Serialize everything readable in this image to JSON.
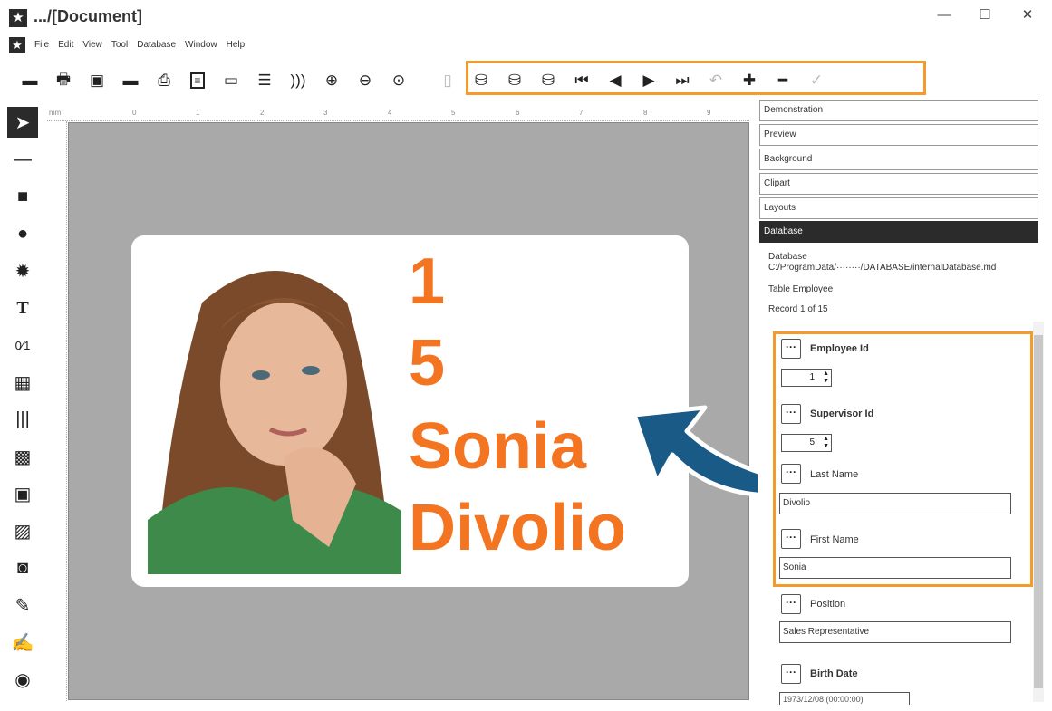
{
  "window": {
    "title": ".../[Document]",
    "controls": {
      "minimize": "—",
      "maximize": "☐",
      "close": "✕"
    }
  },
  "menu": [
    "File",
    "Edit",
    "View",
    "Tool",
    "Database",
    "Window",
    "Help"
  ],
  "toolbar": {
    "icons": [
      "new-card-icon",
      "print-icon",
      "save-icon",
      "new-icon",
      "printer-icon",
      "card-front-icon",
      "card-back-icon",
      "layers-icon",
      "encode-icon",
      "zoom-in-icon",
      "zoom-out-icon",
      "zoom-fit-icon"
    ],
    "db_nav_icons": [
      "db-disabled-icon",
      "db-connect-icon",
      "db-disconnect-icon",
      "db-refresh-icon",
      "db-first-icon",
      "db-previous-icon",
      "db-next-icon",
      "db-last-icon",
      "db-undo-icon",
      "db-add-record-icon",
      "db-remove-record-icon",
      "db-confirm-icon"
    ]
  },
  "left_tools": [
    "pointer-icon",
    "line-icon",
    "rectangle-icon",
    "ellipse-icon",
    "star-shape-icon",
    "text-icon",
    "counter-icon",
    "date-icon",
    "barcode-icon",
    "qrcode-icon",
    "image-icon",
    "picture-icon",
    "camera-icon",
    "signature-pad-icon",
    "sign-icon",
    "fingerprint-icon"
  ],
  "ruler": {
    "unit": "mm",
    "marks": [
      "0",
      "1",
      "2",
      "3",
      "4",
      "5",
      "6",
      "7",
      "8",
      "9"
    ]
  },
  "card": {
    "employee_id": "1",
    "supervisor_id": "5",
    "first_name": "Sonia",
    "last_name": "Divolio"
  },
  "panel": {
    "sections": [
      "Demonstration",
      "Preview",
      "Background",
      "Clipart",
      "Layouts",
      "Database"
    ],
    "active_section": "Database",
    "database_label": "Database",
    "database_path": "C:/ProgramData/········/DATABASE/internalDatabase.md",
    "table": "Table Employee",
    "record": "Record 1 of 15",
    "fields": [
      {
        "label": "Employee Id",
        "bold": true,
        "type": "spin",
        "value": "1"
      },
      {
        "label": "Supervisor Id",
        "bold": true,
        "type": "spin",
        "value": "5"
      },
      {
        "label": "Last Name",
        "bold": false,
        "type": "text",
        "value": "Divolio"
      },
      {
        "label": "First Name",
        "bold": false,
        "type": "text",
        "value": "Sonia"
      },
      {
        "label": "Position",
        "bold": false,
        "type": "text",
        "value": "Sales Representative"
      },
      {
        "label": "Birth Date",
        "bold": true,
        "type": "datetime",
        "value": "1973/12/08 (00:00:00)"
      }
    ]
  },
  "colors": {
    "accent": "#f39b2d",
    "card_text": "#f37421",
    "arrow": "#1a5a87",
    "canvas": "#a9a9a9"
  }
}
